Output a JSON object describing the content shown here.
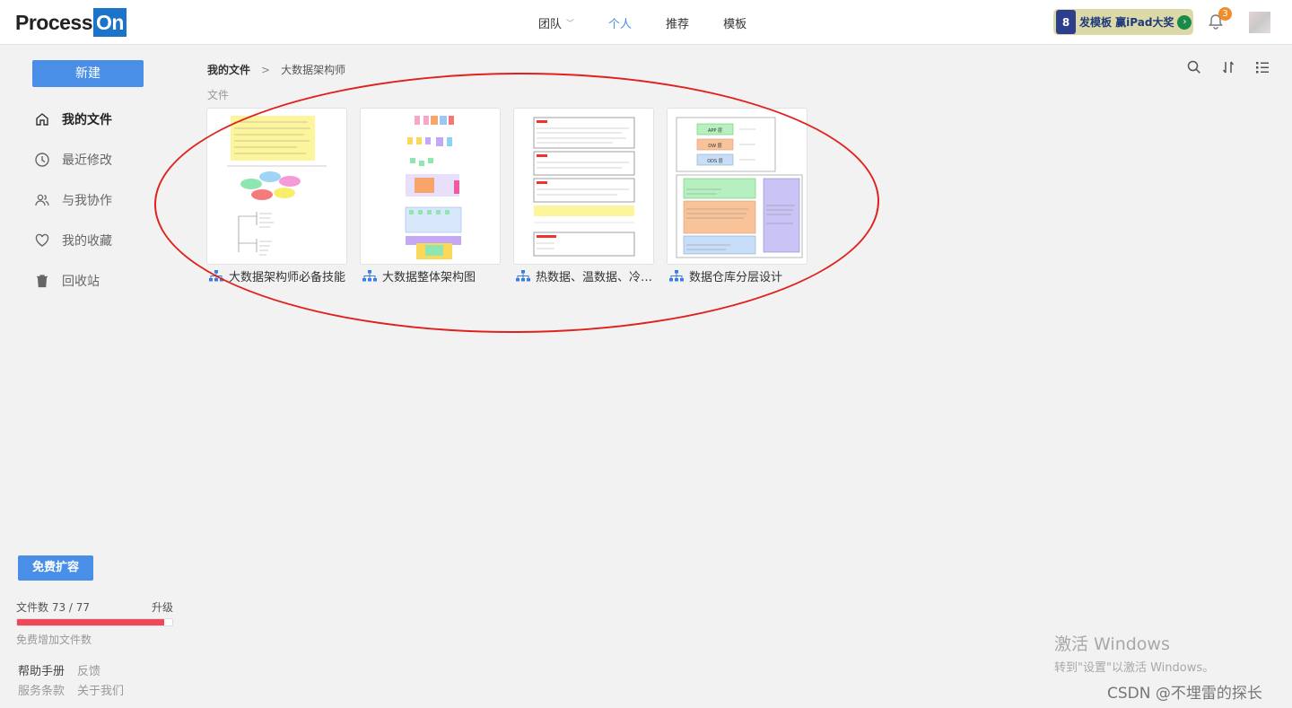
{
  "brand": {
    "logo_text": "Process",
    "logo_badge": "On"
  },
  "nav": {
    "items": [
      {
        "label": "团队",
        "has_dropdown": true
      },
      {
        "label": "个人",
        "active": true
      },
      {
        "label": "推荐"
      },
      {
        "label": "模板"
      }
    ]
  },
  "promo": {
    "text": "发模板 赢iPad大奖"
  },
  "notifications": {
    "count": "3"
  },
  "sidebar": {
    "new_button": "新建",
    "items": [
      {
        "label": "我的文件",
        "icon": "home-icon",
        "active": true
      },
      {
        "label": "最近修改",
        "icon": "clock-icon"
      },
      {
        "label": "与我协作",
        "icon": "users-icon"
      },
      {
        "label": "我的收藏",
        "icon": "heart-icon"
      },
      {
        "label": "回收站",
        "icon": "trash-icon"
      }
    ],
    "expand_button": "免费扩容",
    "file_count": "文件数 73 / 77",
    "file_count_used": 73,
    "file_count_total": 77,
    "upgrade_label": "升级",
    "quota_hint": "免费增加文件数",
    "footer_links": [
      "帮助手册",
      "反馈",
      "服务条款",
      "关于我们"
    ]
  },
  "main": {
    "breadcrumb": {
      "root": "我的文件",
      "separator": ">",
      "current": "大数据架构师"
    },
    "section_label": "文件",
    "files": [
      {
        "title": "大数据架构师必备技能",
        "type_icon": "mindmap-icon"
      },
      {
        "title": "大数据整体架构图",
        "type_icon": "mindmap-icon"
      },
      {
        "title": "热数据、温数据、冷数据",
        "type_icon": "mindmap-icon"
      },
      {
        "title": "数据仓库分层设计",
        "type_icon": "mindmap-icon"
      }
    ]
  },
  "thumb4": {
    "labels": [
      "APP 层",
      "DW 层",
      "ODS 层"
    ]
  },
  "overlay": {
    "windows_title": "激活 Windows",
    "windows_sub": "转到\"设置\"以激活 Windows。",
    "watermark": "CSDN @不埋雷的探长"
  },
  "colors": {
    "accent": "#4a8fe7",
    "quota": "#f04858",
    "annotation": "#e0221d"
  }
}
